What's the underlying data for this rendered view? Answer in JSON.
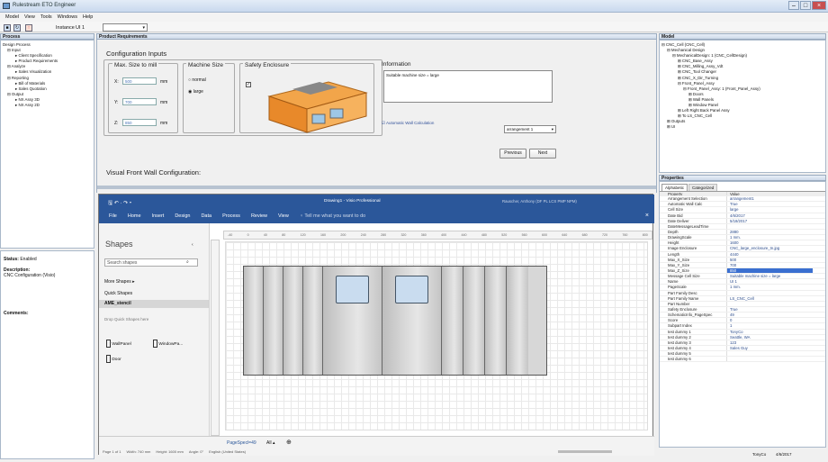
{
  "app": {
    "title": "Rulestream ETO Engineer",
    "menu": [
      "Model",
      "View",
      "Tools",
      "Windows",
      "Help"
    ],
    "instance_label": "Instance",
    "instance_value": "UI 1"
  },
  "process": {
    "header": "Process",
    "items": [
      "Design Process",
      "Input",
      "Client Specification",
      "Product Requirements",
      "Analyze",
      "Sales Visualization",
      "Reporting",
      "Bill of Materials",
      "Sales Quotation",
      "Output",
      "NX Assy 3D",
      "NX Assy 2D"
    ],
    "status_label": "Status:",
    "status_value": "Enabled",
    "description_label": "Description:",
    "description_value": "CNC Configuration (Visio)",
    "comments_label": "Comments:"
  },
  "requirements": {
    "header": "Product Requirements",
    "config_title": "Configuration Inputs",
    "max_size_title": "Max. Size to mill",
    "x_label": "X:",
    "x_value": "500",
    "y_label": "Y:",
    "y_value": "700",
    "z_label": "Z:",
    "z_value": "850",
    "unit": "mm",
    "machine_size_title": "Machine Size",
    "normal_label": "normal",
    "large_label": "large",
    "enclosure_title": "Safety Enclosure",
    "info_title": "Information",
    "info_text": "Suitable machine size = large",
    "auto_wall_label": "Automatic Wall Calculation",
    "arrangement_value": "arrangement 1",
    "previous_label": "Previous",
    "next_label": "Next",
    "visual_title": "Visual Front Wall Configuration:"
  },
  "visio": {
    "title": "Drawing1 - Visio Professional",
    "user": "Rauscher, Anthony (DF PL LCS PMP NPM)",
    "menu": [
      "File",
      "Home",
      "Insert",
      "Design",
      "Data",
      "Process",
      "Review",
      "View"
    ],
    "tell_me": "Tell me what you want to do",
    "shapes_title": "Shapes",
    "search_placeholder": "Search shapes",
    "more_shapes": "More Shapes",
    "quick_shapes": "Quick Shapes",
    "stencil": "AME_stencil",
    "drop_hint": "Drop Quick Shapes here",
    "stencil_items": [
      "WallPanel",
      "WindowPa...",
      "Door"
    ],
    "page_tab": "PageSpecl=49",
    "all_tab": "All",
    "status_page": "Page 1 of 1",
    "status_width": "Width: 740 mm",
    "status_height": "Height: 1600 mm",
    "status_angle": "Angle: 0°",
    "status_lang": "English (United States)",
    "ruler": [
      "-40",
      "0",
      "40",
      "80",
      "120",
      "160",
      "200",
      "240",
      "280",
      "320",
      "360",
      "400",
      "440",
      "480",
      "520",
      "560",
      "600",
      "640",
      "680",
      "720",
      "760",
      "800"
    ]
  },
  "model": {
    "header": "Model",
    "items": [
      "CNC_Cell (CNC_Cell)",
      "Mechanical Design",
      "MechanicalDesign: 1 (CNC_CellDesign)",
      "CNC_Base_Assy",
      "CNC_Milling_Assy_Vdt",
      "CNC_Tool Changer",
      "CNC_X_Dir_Turning",
      "Front_Panel_Assy",
      "Front_Panel_Assy: 1 (Front_Panel_Assy)",
      "Doors",
      "Wall Panels",
      "Window Panel",
      "Left Right Back Panel Assy",
      "To LS_CNC_Cell",
      "Outputs",
      "UI"
    ]
  },
  "properties": {
    "header": "Properties",
    "tabs": [
      "Alphabetic",
      "Categorized"
    ],
    "col_property": "Property",
    "col_value": "Value",
    "rows": [
      [
        "Arrangement Selection",
        "arrangement1"
      ],
      [
        "Automatic Wall Calc",
        "True"
      ],
      [
        "Cell Size",
        "large"
      ],
      [
        "Date Bid",
        "4/6/2017"
      ],
      [
        "Date Deliver",
        "5/18/2017"
      ],
      [
        "DateMessageLeadTime",
        ""
      ],
      [
        "Depth",
        "2880"
      ],
      [
        "DrawingScale",
        "1 mm."
      ],
      [
        "Height",
        "1600"
      ],
      [
        "Image Enclosure",
        "CNC_large_enclosure_tn.jpg"
      ],
      [
        "Length",
        "4440"
      ],
      [
        "Max_X_Size",
        "500"
      ],
      [
        "Max_Y_Size",
        "700"
      ],
      [
        "Max_Z_Size",
        "850"
      ],
      [
        "Message Cell Size",
        "Suitable machine size = large"
      ],
      [
        "Name",
        "UI 1"
      ],
      [
        "PageScale",
        "1 mm."
      ],
      [
        "Part Family Desc",
        ""
      ],
      [
        "Part Family Name",
        "LS_CNC_Cell"
      ],
      [
        "Part Number",
        ""
      ],
      [
        "Safety Enclosure",
        "True"
      ],
      [
        "SchematicInfo_PageSpec",
        "49"
      ],
      [
        "Score",
        "0"
      ],
      [
        "Subpart Index",
        "1"
      ],
      [
        "test dummy 1",
        "TonyCo"
      ],
      [
        "test dummy 2",
        "Seattle, WA"
      ],
      [
        "test dummy 3",
        "123"
      ],
      [
        "test dummy 4",
        "Sales Guy"
      ],
      [
        "test dummy 5",
        ""
      ],
      [
        "test dummy 6",
        ""
      ]
    ]
  },
  "statusbar": {
    "user": "TonyCo",
    "date": "4/6/2017"
  }
}
